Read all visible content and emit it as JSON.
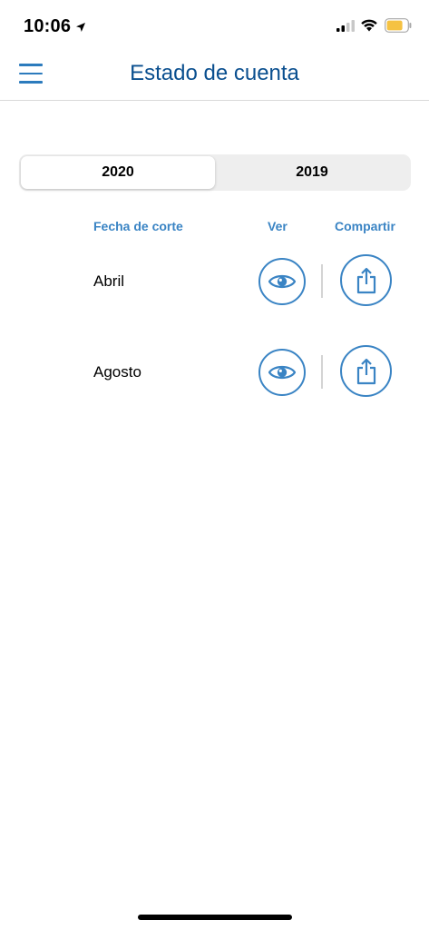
{
  "status_bar": {
    "time": "10:06",
    "location_icon": "location-arrow-icon",
    "signal_icon": "cellular-signal-icon",
    "wifi_icon": "wifi-icon",
    "battery_icon": "battery-icon",
    "battery_color": "#f5c242"
  },
  "nav": {
    "menu_icon": "hamburger-menu-icon",
    "title": "Estado de cuenta"
  },
  "year_selector": {
    "options": [
      "2020",
      "2019"
    ],
    "selected": "2020"
  },
  "table": {
    "headers": {
      "fecha": "Fecha de corte",
      "ver": "Ver",
      "compartir": "Compartir"
    },
    "rows": [
      {
        "label": "Abril",
        "view_icon": "eye-icon",
        "share_icon": "share-icon"
      },
      {
        "label": "Agosto",
        "view_icon": "eye-icon",
        "share_icon": "share-icon"
      }
    ]
  },
  "colors": {
    "accent": "#3a84c4",
    "title": "#0a4f8f"
  }
}
